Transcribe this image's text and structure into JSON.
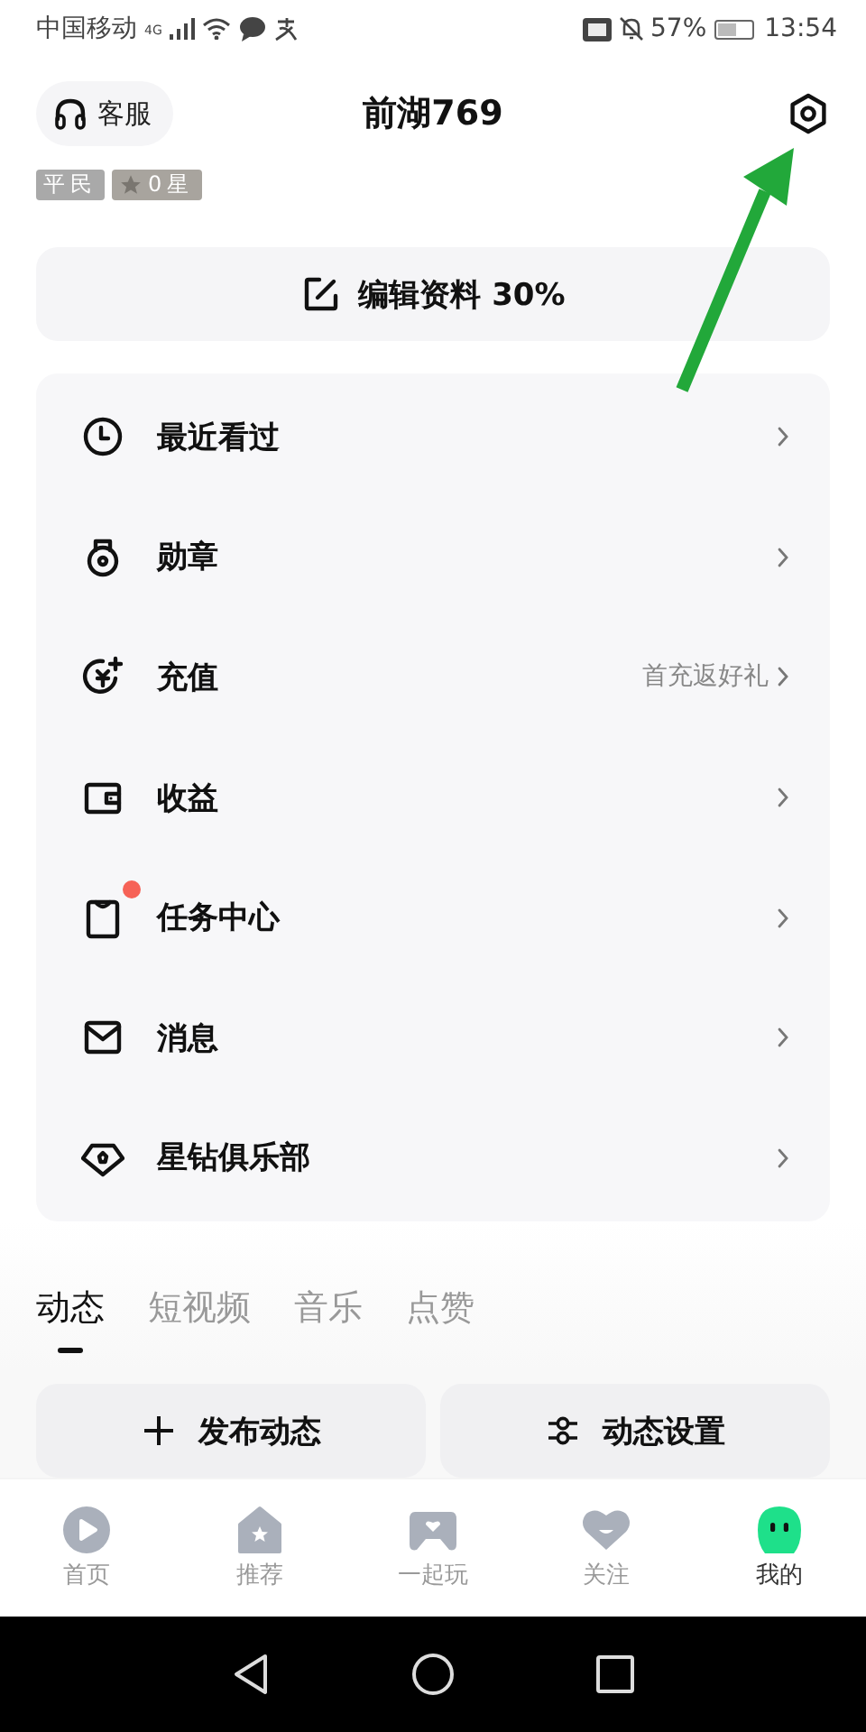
{
  "status_bar": {
    "carrier": "中国移动",
    "network": "4G",
    "battery": "57%",
    "time": "13:54"
  },
  "header": {
    "service_button": "客服",
    "title": "前湖769"
  },
  "badges": [
    {
      "kind": "rank",
      "label": "平民"
    },
    {
      "kind": "star",
      "label": "0星"
    }
  ],
  "edit_profile": "编辑资料 30%",
  "menu": [
    {
      "kind": "history",
      "label": "最近看过",
      "dot": false
    },
    {
      "kind": "medal",
      "label": "勋章",
      "dot": false
    },
    {
      "kind": "recharge",
      "label": "充值",
      "note": "首充返好礼",
      "dot": false
    },
    {
      "kind": "wallet",
      "label": "收益",
      "dot": false
    },
    {
      "kind": "task",
      "label": "任务中心",
      "dot": true
    },
    {
      "kind": "mail",
      "label": "消息",
      "dot": false
    },
    {
      "kind": "diamond",
      "label": "星钻俱乐部",
      "dot": false
    }
  ],
  "tabs": [
    {
      "label": "动态",
      "selected": true
    },
    {
      "label": "短视频",
      "selected": false
    },
    {
      "label": "音乐",
      "selected": false
    },
    {
      "label": "点赞",
      "selected": false
    }
  ],
  "actions": [
    {
      "kind": "add",
      "label": "发布动态"
    },
    {
      "kind": "settings",
      "label": "动态设置"
    }
  ],
  "bottom_nav": [
    {
      "kind": "play",
      "label": "首页",
      "selected": false
    },
    {
      "kind": "house",
      "label": "推荐",
      "selected": false
    },
    {
      "kind": "gamepad",
      "label": "一起玩",
      "selected": false
    },
    {
      "kind": "heart",
      "label": "关注",
      "selected": false
    },
    {
      "kind": "face",
      "label": "我的",
      "selected": true
    }
  ]
}
